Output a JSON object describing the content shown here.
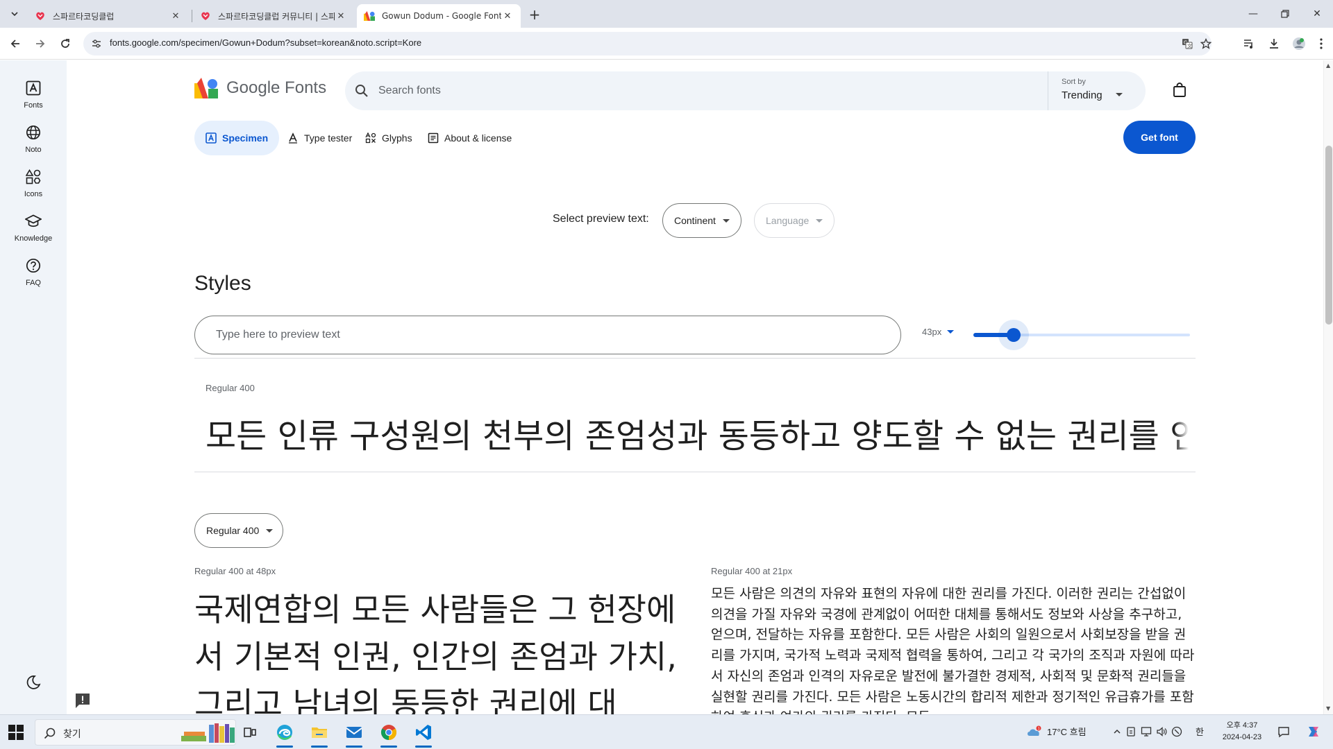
{
  "browser": {
    "tabs": [
      {
        "title": "스파르타코딩클럽",
        "active": false
      },
      {
        "title": "스파르타코딩클럽 커뮤니티 | 스파르타",
        "active": false
      },
      {
        "title": "Gowun Dodum - Google Fonts",
        "active": true
      }
    ],
    "url": "fonts.google.com/specimen/Gowun+Dodum?subset=korean&noto.script=Kore"
  },
  "rail": {
    "items": [
      {
        "label": "Fonts",
        "icon": "fonts-icon"
      },
      {
        "label": "Noto",
        "icon": "globe-icon"
      },
      {
        "label": "Icons",
        "icon": "shapes-icon"
      },
      {
        "label": "Knowledge",
        "icon": "graduation-cap-icon"
      },
      {
        "label": "FAQ",
        "icon": "help-circle-icon"
      }
    ]
  },
  "header": {
    "brand": "Google Fonts",
    "search_placeholder": "Search fonts",
    "sort_caption": "Sort by",
    "sort_value": "Trending"
  },
  "tabs": [
    {
      "label": "Specimen",
      "active": true
    },
    {
      "label": "Type tester",
      "active": false
    },
    {
      "label": "Glyphs",
      "active": false
    },
    {
      "label": "About & license",
      "active": false
    }
  ],
  "get_font_label": "Get font",
  "preview": {
    "label": "Select preview text:",
    "continent": "Continent",
    "language": "Language"
  },
  "styles": {
    "heading": "Styles",
    "type_placeholder": "Type here to preview text",
    "size": "43px",
    "size_level": 0.14,
    "style_name": "Regular 400",
    "sample": "모든 인류 구성원의 천부의 존엄성과 동등하고 양도할 수 없는 권리를 인정하는 것이 세계의 자유, 정의 및 평화의 기초이며"
  },
  "paragraphs": {
    "weight_select": "Regular 400",
    "left_caption": "Regular 400 at 48px",
    "right_caption": "Regular 400 at 21px",
    "left_text": "국제연합의 모든 사람들은 그 헌장에서 기본적 인권, 인간의 존엄과 가치, 그리고 남녀의 동등한 권리에 대",
    "right_text": "모든 사람은 의견의 자유와 표현의 자유에 대한 권리를 가진다. 이러한 권리는 간섭없이 의견을 가질 자유와 국경에 관계없이 어떠한 대체를 통해서도 정보와 사상을 추구하고, 얻으며, 전달하는 자유를 포함한다. 모든 사람은 사회의 일원으로서 사회보장을 받을 권리를 가지며, 국가적 노력과 국제적 협력을 통하여, 그리고 각 국가의 조직과 자원에 따라서 자신의 존엄과 인격의 자유로운 발전에 불가결한 경제적, 사회적 및 문화적 권리들을 실현할 권리를 가진다. 모든 사람은 노동시간의 합리적 제한과 정기적인 유급휴가를 포함하여 휴식과 여가의 권리를 가진다. 모든"
  },
  "taskbar": {
    "search_text": "찾기",
    "weather": "17°C 흐림",
    "ime": "한",
    "time": "오후 4:37",
    "date": "2024-04-23"
  },
  "colors": {
    "accent": "#0b57d0",
    "rail_bg": "#f0f4f9",
    "tab_strip": "#dfe3eb"
  }
}
